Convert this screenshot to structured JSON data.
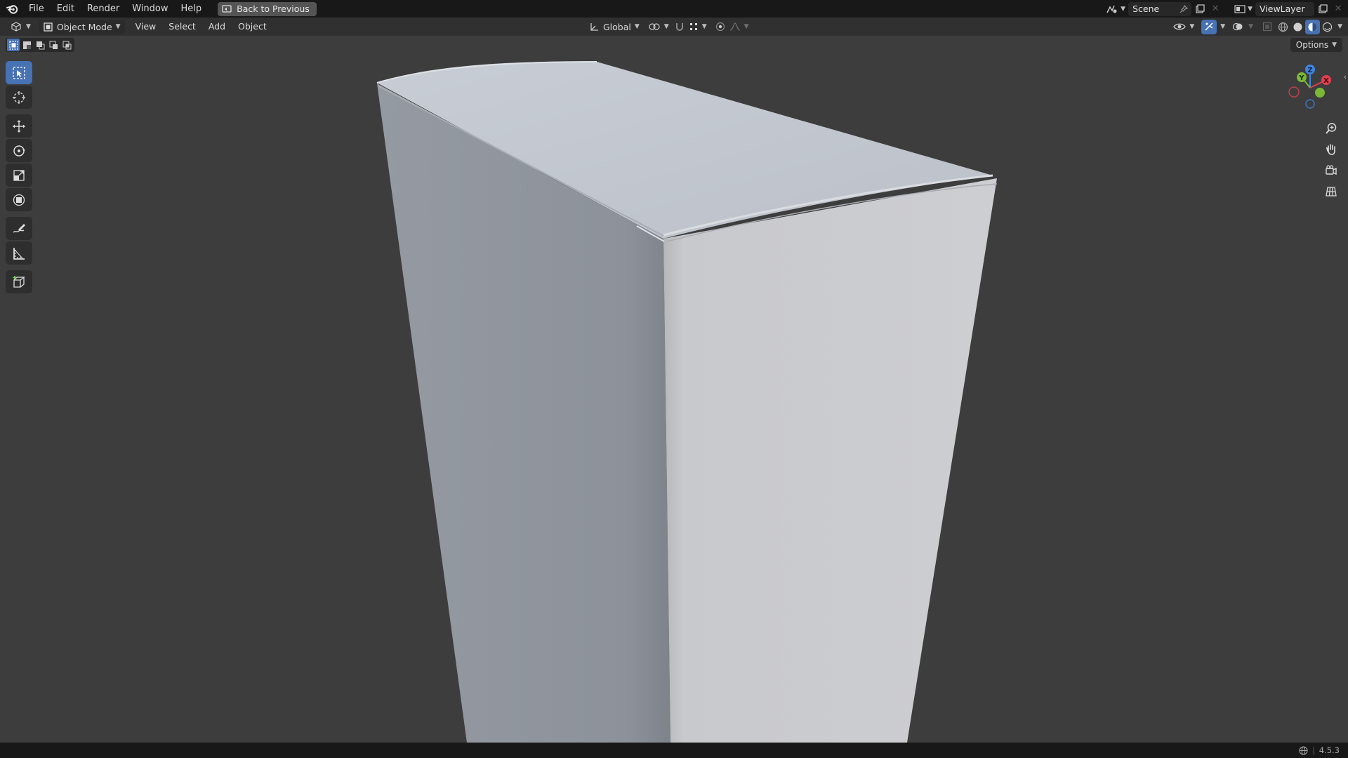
{
  "topbar": {
    "menus": [
      "File",
      "Edit",
      "Render",
      "Window",
      "Help"
    ],
    "back_button": "Back to Previous",
    "scene_name": "Scene",
    "view_layer": "ViewLayer"
  },
  "header": {
    "mode": "Object Mode",
    "menus": [
      "View",
      "Select",
      "Add",
      "Object"
    ],
    "transform_orientation": "Global"
  },
  "viewport": {
    "options_label": "Options",
    "gizmo_axes": [
      "X",
      "Y",
      "Z"
    ],
    "object_colors": {
      "top": "#c3c8d0",
      "left": "#8f949c",
      "right": "#cbccd0"
    }
  },
  "status": {
    "version": "4.5.3"
  },
  "colors": {
    "accent": "#4772b3",
    "axis_x": "#e0404f",
    "axis_y": "#7ab836",
    "axis_z": "#3f84e0"
  }
}
